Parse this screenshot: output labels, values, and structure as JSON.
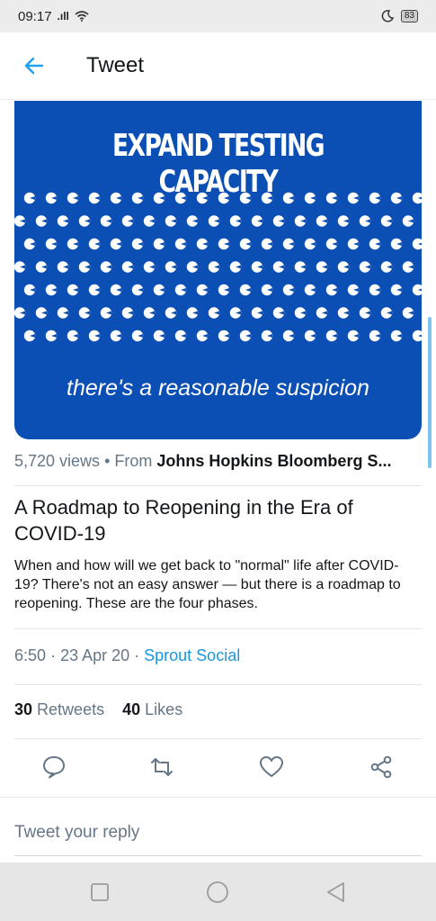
{
  "status_bar": {
    "time": "09:17",
    "signal": ".ıll",
    "battery": "83"
  },
  "header": {
    "title": "Tweet"
  },
  "media": {
    "headline": "EXPAND TESTING CAPACITY",
    "caption": "there's a reasonable suspicion",
    "background_color": "#0b4fb4"
  },
  "card": {
    "views": "5,720 views",
    "separator": "•",
    "from_prefix": "From",
    "from_source": "Johns Hopkins Bloomberg S...",
    "title": "A Roadmap to Reopening in the Era of COVID-19",
    "description": "When and how will we get back to \"normal\" life after COVID-19?  There's not an easy answer — but there is a roadmap to reopening. These are the four phases."
  },
  "meta": {
    "time": "6:50",
    "date": "23 Apr 20",
    "source": "Sprout Social"
  },
  "stats": {
    "retweets_count": "30",
    "retweets_label": "Retweets",
    "likes_count": "40",
    "likes_label": "Likes"
  },
  "actions": [
    "reply-icon",
    "retweet-icon",
    "like-icon",
    "share-icon"
  ],
  "reply": {
    "placeholder": "Tweet your reply"
  },
  "nav": [
    "recent-apps-icon",
    "home-icon",
    "back-icon"
  ],
  "colors": {
    "accent": "#1b95e0",
    "muted": "#657786"
  }
}
